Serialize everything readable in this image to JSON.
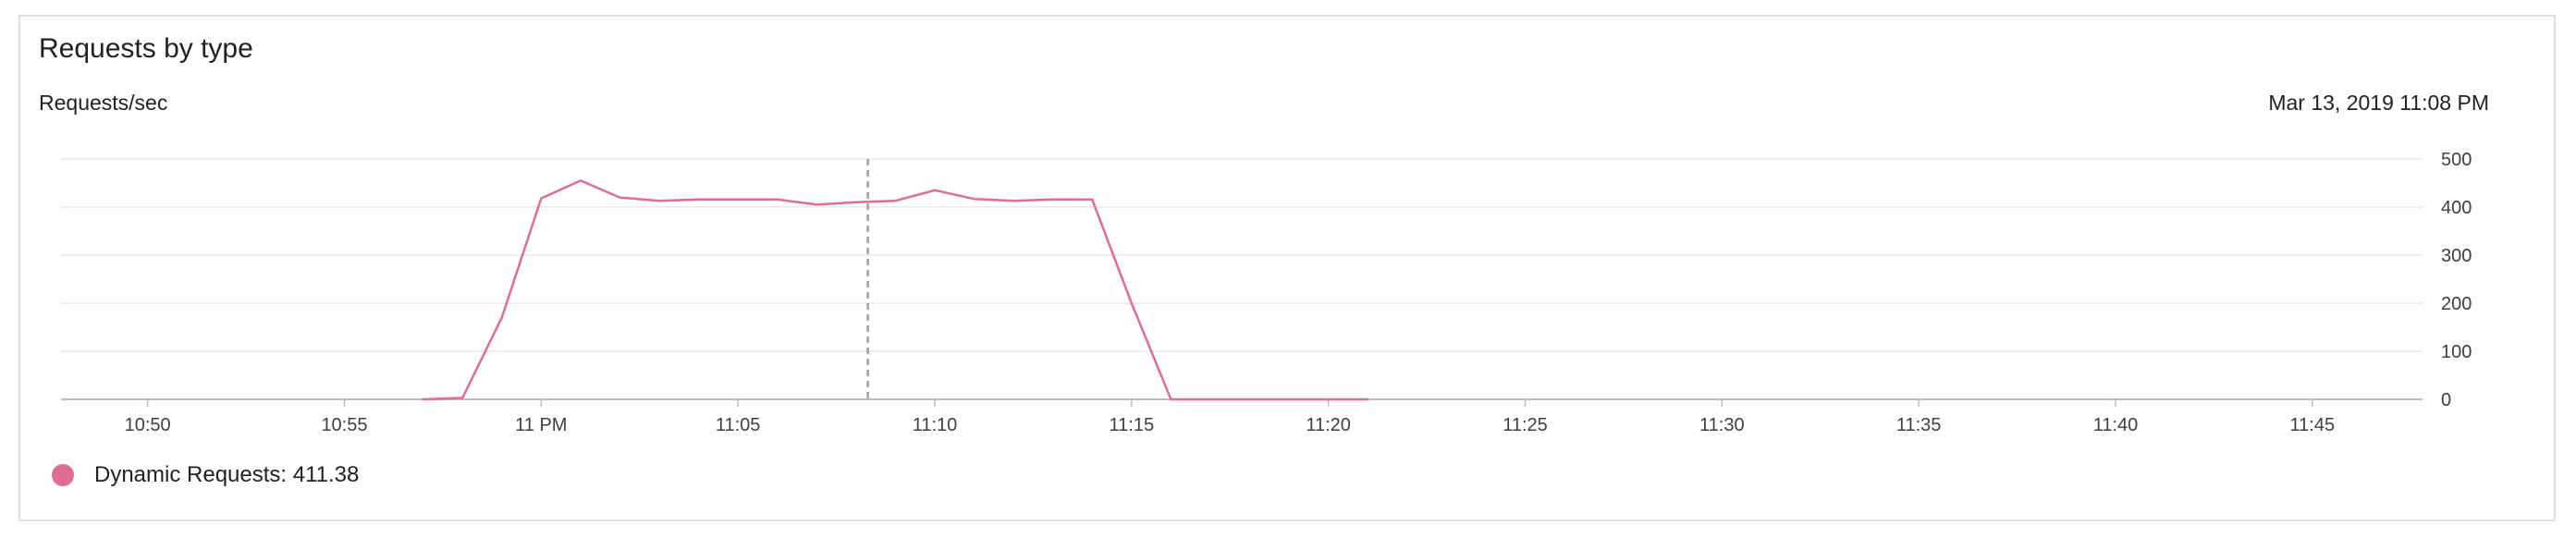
{
  "card": {
    "title": "Requests by type",
    "y_axis_label": "Requests/sec",
    "timestamp": "Mar 13, 2019 11:08 PM"
  },
  "legend": {
    "series_name": "Dynamic Requests",
    "value": "411.38",
    "text": "Dynamic Requests: 411.38",
    "color": "#e06c96"
  },
  "chart_data": {
    "type": "line",
    "title": "Requests by type",
    "ylabel": "Requests/sec",
    "xlabel": "",
    "x_unit": "minutes after 10:50 PM, Mar 13, 2019",
    "xlim": [
      -2.2,
      57.8
    ],
    "ylim": [
      0,
      500
    ],
    "y_ticks": [
      0,
      100,
      200,
      300,
      400,
      500
    ],
    "x_ticks": [
      {
        "value": 0,
        "label": "10:50"
      },
      {
        "value": 5,
        "label": "10:55"
      },
      {
        "value": 10,
        "label": "11 PM"
      },
      {
        "value": 15,
        "label": "11:05"
      },
      {
        "value": 20,
        "label": "11:10"
      },
      {
        "value": 25,
        "label": "11:15"
      },
      {
        "value": 30,
        "label": "11:20"
      },
      {
        "value": 35,
        "label": "11:25"
      },
      {
        "value": 40,
        "label": "11:30"
      },
      {
        "value": 45,
        "label": "11:35"
      },
      {
        "value": 50,
        "label": "11:40"
      },
      {
        "value": 55,
        "label": "11:45"
      }
    ],
    "grid": true,
    "y_axis_side": "right",
    "legend_position": "bottom-left",
    "cursor_x": 18.3,
    "series": [
      {
        "name": "Dynamic Requests",
        "color": "#e06c96",
        "points": [
          [
            7,
            0
          ],
          [
            8,
            3
          ],
          [
            9,
            170
          ],
          [
            10,
            418
          ],
          [
            11,
            455
          ],
          [
            12,
            420
          ],
          [
            13,
            413
          ],
          [
            14,
            416
          ],
          [
            15,
            416
          ],
          [
            16,
            416
          ],
          [
            17,
            405
          ],
          [
            18,
            410
          ],
          [
            19,
            413
          ],
          [
            20,
            435
          ],
          [
            21,
            417
          ],
          [
            22,
            413
          ],
          [
            23,
            416
          ],
          [
            24,
            416
          ],
          [
            25,
            200
          ],
          [
            26,
            0
          ],
          [
            27,
            0
          ],
          [
            28,
            0
          ],
          [
            29,
            0
          ],
          [
            30,
            0
          ],
          [
            31,
            0
          ]
        ]
      }
    ]
  }
}
